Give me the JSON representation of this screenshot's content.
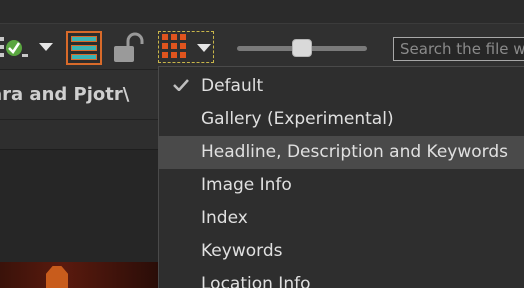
{
  "toolbar": {
    "search_placeholder": "Search the file wir",
    "slider_level_fraction": 0.45,
    "colors": {
      "accent_orange": "#d86a2a",
      "accent_teal": "#3bb3b3",
      "grid_orange": "#e0541e"
    }
  },
  "path": {
    "text": "ara and Pjotr\\"
  },
  "menu": {
    "items": [
      {
        "label": "Default",
        "checked": true
      },
      {
        "label": "Gallery (Experimental)",
        "checked": false
      },
      {
        "label": "Headline, Description and Keywords",
        "checked": false,
        "highlighted": true
      },
      {
        "label": "Image Info",
        "checked": false
      },
      {
        "label": "Index",
        "checked": false
      },
      {
        "label": "Keywords",
        "checked": false
      },
      {
        "label": "Location Info",
        "checked": false
      }
    ]
  }
}
